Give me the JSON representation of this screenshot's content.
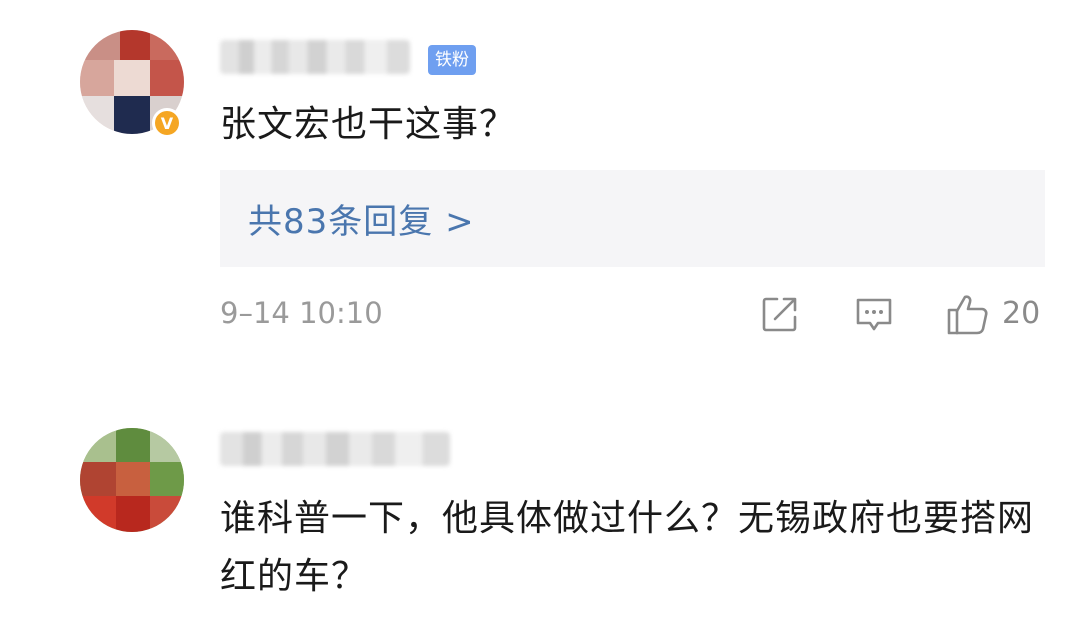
{
  "comments": [
    {
      "fan_badge": "铁粉",
      "verified_mark": "V",
      "text": "张文宏也干这事？",
      "replies_link": "共83条回复 >",
      "time": "9–14 10:10",
      "likes": "20",
      "icons": [
        "share-icon",
        "reply-icon",
        "like-icon"
      ]
    },
    {
      "text": "谁科普一下，他具体做过什么？无锡政府也要搭网红的车？"
    }
  ],
  "colors": {
    "link": "#4a76ae",
    "fan_badge": "#6f9ff0",
    "verified": "#f5a623",
    "meta": "#9a9a9a",
    "reply_bg": "#f5f5f7"
  }
}
